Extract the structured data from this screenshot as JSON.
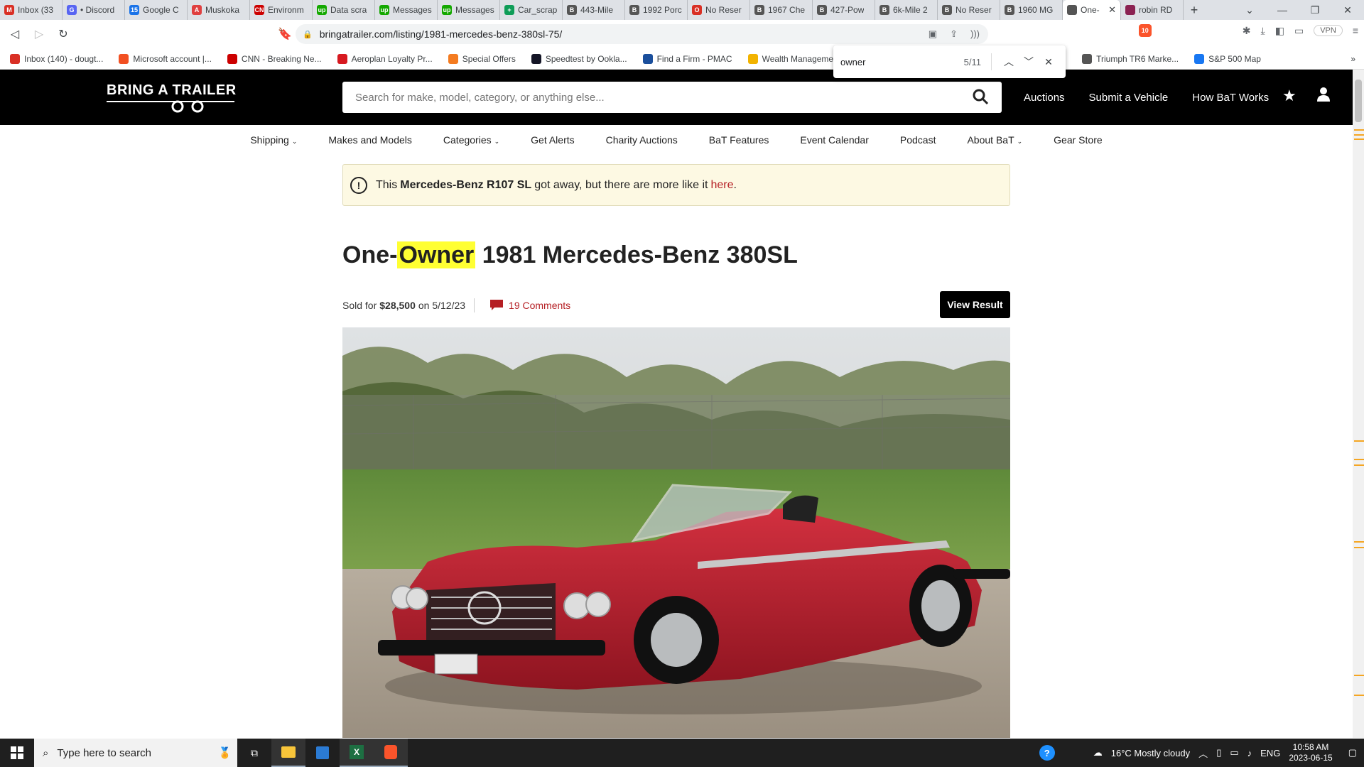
{
  "browser": {
    "tabs": [
      {
        "label": "Inbox (33",
        "fav": "#d93025",
        "glyph": "M"
      },
      {
        "label": "• Discord",
        "fav": "#5865f2",
        "glyph": "G"
      },
      {
        "label": "Google C",
        "fav": "#1a73e8",
        "glyph": "15"
      },
      {
        "label": "Muskoka",
        "fav": "#e04040",
        "glyph": "A"
      },
      {
        "label": "Environm",
        "fav": "#cc0000",
        "glyph": "CN"
      },
      {
        "label": "Data scra",
        "fav": "#14a800",
        "glyph": "up"
      },
      {
        "label": "Messages",
        "fav": "#14a800",
        "glyph": "up"
      },
      {
        "label": "Messages",
        "fav": "#14a800",
        "glyph": "up"
      },
      {
        "label": "Car_scrap",
        "fav": "#0f9d58",
        "glyph": "+"
      },
      {
        "label": "443-Mile",
        "fav": "#555555",
        "glyph": "B"
      },
      {
        "label": "1992 Porc",
        "fav": "#555555",
        "glyph": "B"
      },
      {
        "label": "No Reser",
        "fav": "#d93025",
        "glyph": "O"
      },
      {
        "label": "1967 Che",
        "fav": "#555555",
        "glyph": "B"
      },
      {
        "label": "427-Pow",
        "fav": "#555555",
        "glyph": "B"
      },
      {
        "label": "6k-Mile 2",
        "fav": "#555555",
        "glyph": "B"
      },
      {
        "label": "No Reser",
        "fav": "#555555",
        "glyph": "B"
      },
      {
        "label": "1960 MG",
        "fav": "#555555",
        "glyph": "B"
      }
    ],
    "active_tab": {
      "label": "One-",
      "close": "✕"
    },
    "extra_tab": {
      "label": "robin RD",
      "fav": "#8b2252"
    },
    "new_tab": "+",
    "window_controls": [
      "⌄",
      "—",
      "❐",
      "✕"
    ],
    "url": "bringatrailer.com/listing/1981-mercedes-benz-380sl-75/",
    "vpn": "VPN",
    "shield_badge": "10",
    "bookmarks": [
      {
        "label": "Inbox (140) - dougt...",
        "fav": "#d93025"
      },
      {
        "label": "Microsoft account |...",
        "fav": "#f25022"
      },
      {
        "label": "CNN - Breaking Ne...",
        "fav": "#cc0000"
      },
      {
        "label": "Aeroplan Loyalty Pr...",
        "fav": "#d71920"
      },
      {
        "label": "Special Offers",
        "fav": "#f47b20"
      },
      {
        "label": "Speedtest by Ookla...",
        "fav": "#141526"
      },
      {
        "label": "Find a Firm - PMAC",
        "fav": "#1b4f9c"
      },
      {
        "label": "Wealth Manageme...",
        "fav": "#f2b300"
      }
    ],
    "bookmarks_right": [
      {
        "label": "Triumph TR6 Marke...",
        "fav": "#555555"
      },
      {
        "label": "S&P 500 Map",
        "fav": "#1877f2"
      }
    ],
    "bookmarks_more": "»",
    "find": {
      "query": "owner",
      "count": "5/11"
    }
  },
  "site": {
    "logo": "BRING A TRAILER",
    "search_placeholder": "Search for make, model, category, or anything else...",
    "nav": [
      "Auctions",
      "Submit a Vehicle",
      "How BaT Works"
    ],
    "subnav": [
      {
        "label": "Shipping",
        "dropdown": true
      },
      {
        "label": "Makes and Models",
        "dropdown": false
      },
      {
        "label": "Categories",
        "dropdown": true
      },
      {
        "label": "Get Alerts",
        "dropdown": false
      },
      {
        "label": "Charity Auctions",
        "dropdown": false
      },
      {
        "label": "BaT Features",
        "dropdown": false
      },
      {
        "label": "Event Calendar",
        "dropdown": false
      },
      {
        "label": "Podcast",
        "dropdown": false
      },
      {
        "label": "About BaT",
        "dropdown": true
      },
      {
        "label": "Gear Store",
        "dropdown": false
      }
    ],
    "subnav_chevron": "⌄",
    "alert": {
      "prefix": "This",
      "model": "Mercedes-Benz R107 SL",
      "middle": "got away, but there are more like it",
      "link": "here",
      "suffix": "."
    },
    "title_pre": "One-",
    "title_highlight": "Owner",
    "title_post": " 1981 Mercedes-Benz 380SL",
    "sold_prefix": "Sold for",
    "sold_price": "$28,500",
    "sold_date": "on 5/12/23",
    "comments": "19 Comments",
    "view_result": "View Result",
    "accent": "#b51f24"
  },
  "taskbar": {
    "search_placeholder": "Type here to search",
    "weather": "16°C  Mostly cloudy",
    "lang": "ENG",
    "time": "10:58 AM",
    "date": "2023-06-15"
  }
}
